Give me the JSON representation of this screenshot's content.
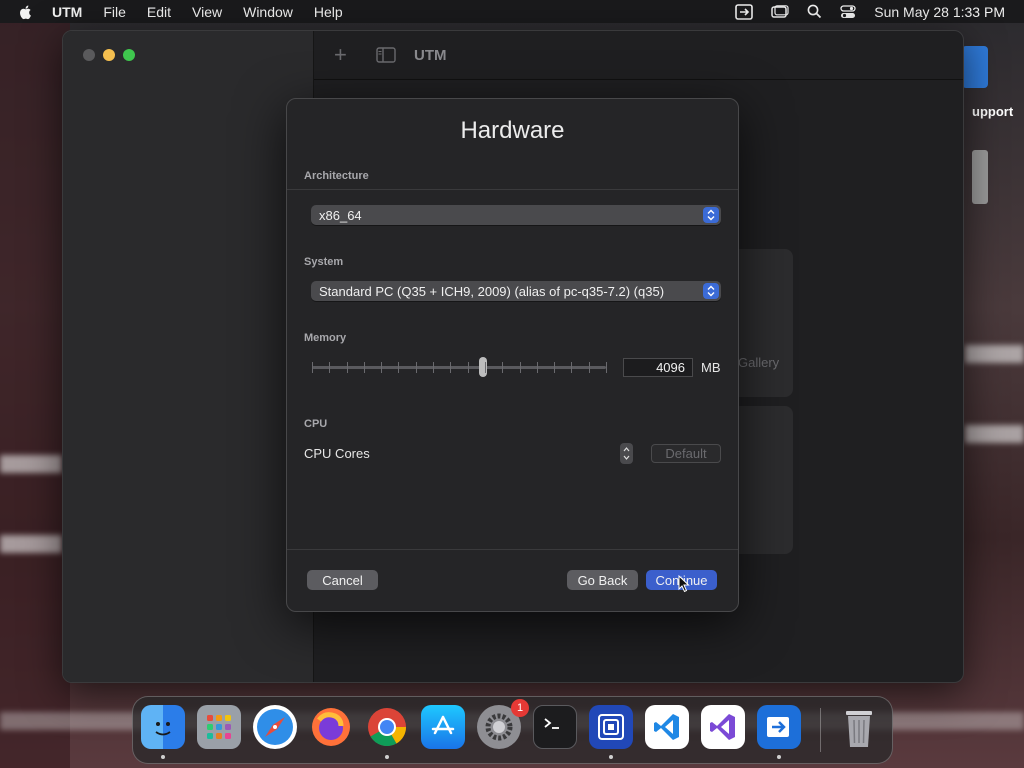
{
  "menubar": {
    "app_name": "UTM",
    "items": [
      "File",
      "Edit",
      "View",
      "Window",
      "Help"
    ],
    "clock": "Sun May 28  1:33 PM"
  },
  "utm_window": {
    "title": "UTM",
    "gallery_text": "Gallery"
  },
  "desktop": {
    "support_text": "upport"
  },
  "sheet": {
    "title": "Hardware",
    "architecture": {
      "label": "Architecture",
      "value": "x86_64"
    },
    "system": {
      "label": "System",
      "value": "Standard PC (Q35 + ICH9, 2009) (alias of pc-q35-7.2) (q35)"
    },
    "memory": {
      "label": "Memory",
      "value": "4096",
      "unit": "MB",
      "slider_fraction": 0.58
    },
    "cpu": {
      "label": "CPU",
      "cores_label": "CPU Cores",
      "default_label": "Default"
    },
    "buttons": {
      "cancel": "Cancel",
      "back": "Go Back",
      "continue": "Continue"
    }
  },
  "dock": {
    "apps": [
      {
        "name": "Finder",
        "icon": "finder-icon",
        "running": true
      },
      {
        "name": "Launchpad",
        "icon": "launchpad-icon",
        "running": false
      },
      {
        "name": "Safari",
        "icon": "safari-icon",
        "running": false
      },
      {
        "name": "Firefox",
        "icon": "firefox-icon",
        "running": false
      },
      {
        "name": "Chrome",
        "icon": "chrome-icon",
        "running": true
      },
      {
        "name": "App Store",
        "icon": "app-store-icon",
        "running": false
      },
      {
        "name": "System Settings",
        "icon": "settings-icon",
        "running": false
      },
      {
        "name": "Terminal",
        "icon": "terminal-icon",
        "running": false
      },
      {
        "name": "UTM",
        "icon": "utm-icon",
        "running": true
      },
      {
        "name": "VS Code",
        "icon": "vscode-icon",
        "running": false
      },
      {
        "name": "Visual Studio",
        "icon": "visual-studio-icon",
        "running": false
      },
      {
        "name": "Migration",
        "icon": "migration-icon",
        "running": true
      },
      {
        "name": "Trash",
        "icon": "trash-icon",
        "running": false
      }
    ],
    "settings_badge": "1"
  }
}
